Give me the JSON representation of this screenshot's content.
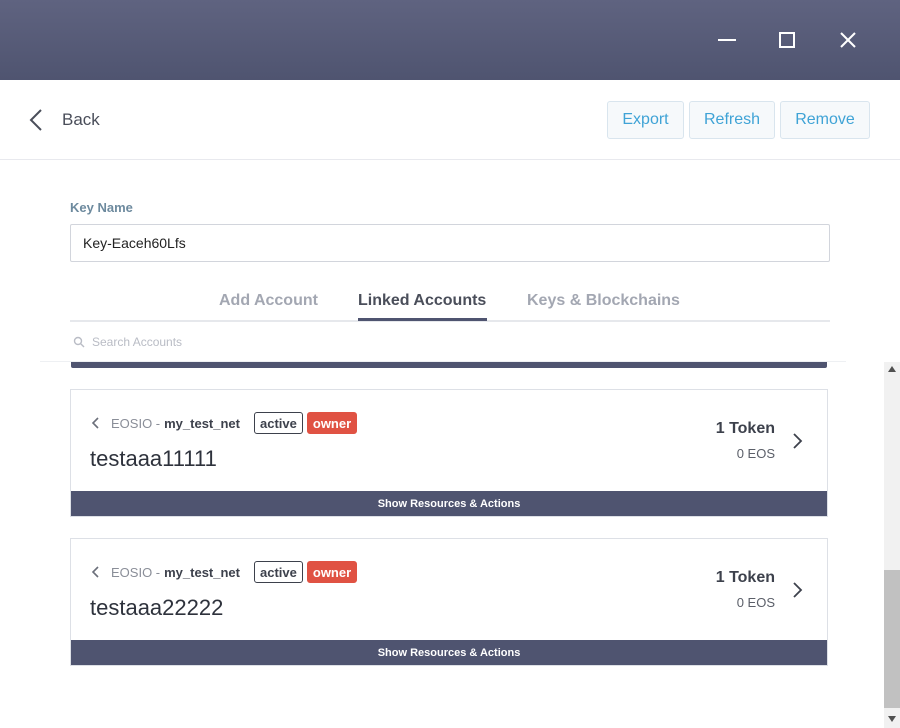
{
  "window": {
    "minimize_icon": "minimize-icon",
    "maximize_icon": "maximize-icon",
    "close_icon": "close-icon"
  },
  "header": {
    "back_label": "Back",
    "export_label": "Export",
    "refresh_label": "Refresh",
    "remove_label": "Remove"
  },
  "key": {
    "label": "Key Name",
    "value": "Key-Eaceh60Lfs"
  },
  "tabs": [
    {
      "label": "Add Account",
      "active": false
    },
    {
      "label": "Linked Accounts",
      "active": true
    },
    {
      "label": "Keys & Blockchains",
      "active": false
    }
  ],
  "search": {
    "placeholder": "Search Accounts"
  },
  "accounts": [
    {
      "chain": "EOSIO -",
      "network": "my_test_net",
      "badges": [
        "active",
        "owner"
      ],
      "name": "testaaa11111",
      "tokens": "1 Token",
      "balance": "0 EOS",
      "show_label": "Show Resources & Actions"
    },
    {
      "chain": "EOSIO -",
      "network": "my_test_net",
      "badges": [
        "active",
        "owner"
      ],
      "name": "testaaa22222",
      "tokens": "1 Token",
      "balance": "0 EOS",
      "show_label": "Show Resources & Actions"
    }
  ],
  "colors": {
    "titlebar": "#555a76",
    "accent_blue": "#3fa3d6",
    "owner_red": "#e05243",
    "dark_bar": "#4f5470"
  }
}
